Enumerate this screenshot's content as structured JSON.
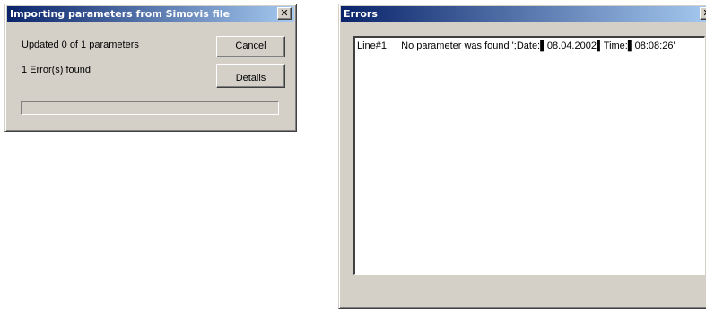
{
  "import_dialog": {
    "title": "Importing parameters from Simovis file",
    "close_glyph": "✕",
    "status_text": "Updated 0 of 1 parameters",
    "error_count_text": "1 Error(s) found",
    "cancel_label": "Cancel",
    "details_label": "Details",
    "progress_fraction": 0
  },
  "errors_window": {
    "title": "Errors",
    "close_glyph": "✕",
    "entries": [
      {
        "line_label": "Line#1:",
        "message": "No parameter was found ';Date:▌08.04.2002▌Time:▌08:08:26'"
      }
    ]
  }
}
